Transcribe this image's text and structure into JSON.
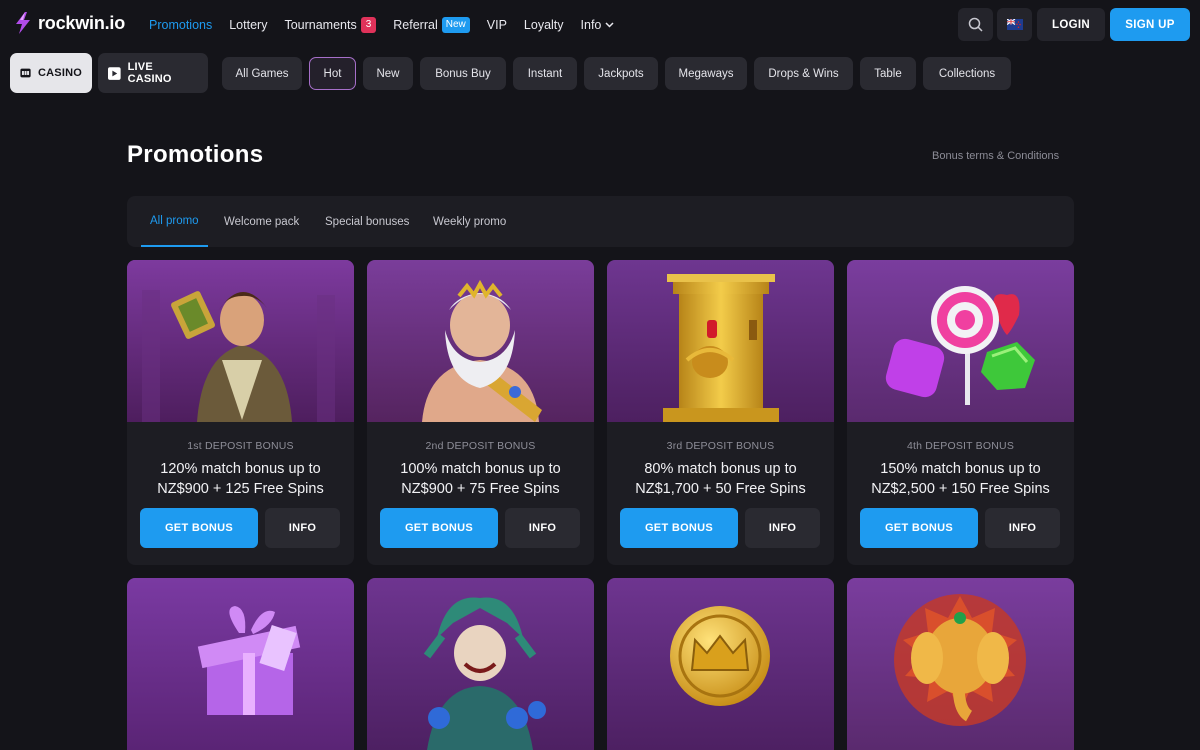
{
  "brand": {
    "name": "rockwin.io"
  },
  "nav": {
    "items": [
      {
        "label": "Promotions"
      },
      {
        "label": "Lottery"
      },
      {
        "label": "Tournaments",
        "badge": "3"
      },
      {
        "label": "Referral",
        "badge": "New"
      },
      {
        "label": "VIP"
      },
      {
        "label": "Loyalty"
      },
      {
        "label": "Info"
      }
    ],
    "login": "LOGIN",
    "signup": "SIGN UP"
  },
  "categories": {
    "casino": "CASINO",
    "live": "LIVE CASINO"
  },
  "filters": [
    "All Games",
    "Hot",
    "New",
    "Bonus Buy",
    "Instant",
    "Jackpots",
    "Megaways",
    "Drops & Wins",
    "Table",
    "Collections"
  ],
  "page": {
    "title": "Promotions",
    "terms": "Bonus terms & Conditions"
  },
  "tabs": [
    "All promo",
    "Welcome pack",
    "Special bonuses",
    "Weekly promo"
  ],
  "cards": [
    {
      "subtitle": "1st DEPOSIT BONUS",
      "line1": "120% match bonus up to",
      "line2": "NZ$900 + 125 Free Spins",
      "button": "GET BONUS",
      "info": "INFO"
    },
    {
      "subtitle": "2nd DEPOSIT BONUS",
      "line1": "100% match bonus up to",
      "line2": "NZ$900 + 75 Free Spins",
      "button": "GET BONUS",
      "info": "INFO"
    },
    {
      "subtitle": "3rd DEPOSIT BONUS",
      "line1": "80% match bonus up to",
      "line2": "NZ$1,700 + 50 Free Spins",
      "button": "GET BONUS",
      "info": "INFO"
    },
    {
      "subtitle": "4th DEPOSIT BONUS",
      "line1": "150% match bonus up to",
      "line2": "NZ$2,500 + 150 Free Spins",
      "button": "GET BONUS",
      "info": "INFO"
    }
  ],
  "colors": {
    "accent": "#1e9bf0",
    "background": "#141419",
    "card": "#1d1d23",
    "badge_red": "#e0325a"
  }
}
